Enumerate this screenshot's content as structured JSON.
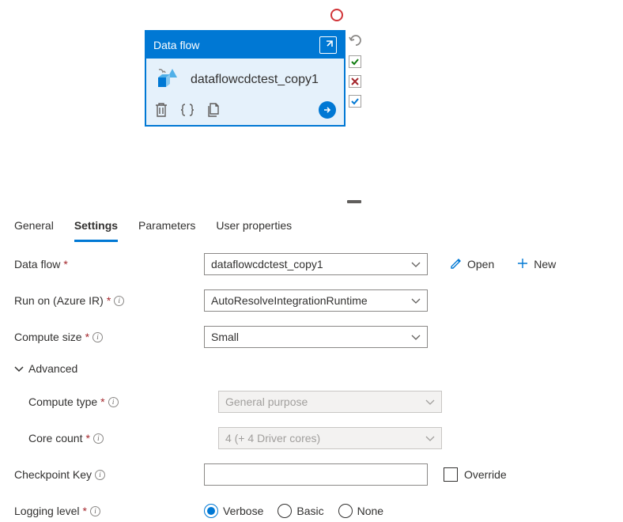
{
  "card": {
    "header": "Data flow",
    "name": "dataflowcdctest_copy1"
  },
  "tabs": {
    "general": "General",
    "settings": "Settings",
    "parameters": "Parameters",
    "user_properties": "User properties"
  },
  "form": {
    "data_flow": {
      "label": "Data flow",
      "value": "dataflowcdctest_copy1",
      "open": "Open",
      "new": "New"
    },
    "run_on": {
      "label": "Run on (Azure IR)",
      "value": "AutoResolveIntegrationRuntime"
    },
    "compute_size": {
      "label": "Compute size",
      "value": "Small"
    },
    "advanced_label": "Advanced",
    "compute_type": {
      "label": "Compute type",
      "value": "General purpose"
    },
    "core_count": {
      "label": "Core count",
      "value": "4 (+ 4 Driver cores)"
    },
    "checkpoint": {
      "label": "Checkpoint Key",
      "value": "",
      "override": "Override"
    },
    "logging": {
      "label": "Logging level",
      "verbose": "Verbose",
      "basic": "Basic",
      "none": "None"
    }
  }
}
